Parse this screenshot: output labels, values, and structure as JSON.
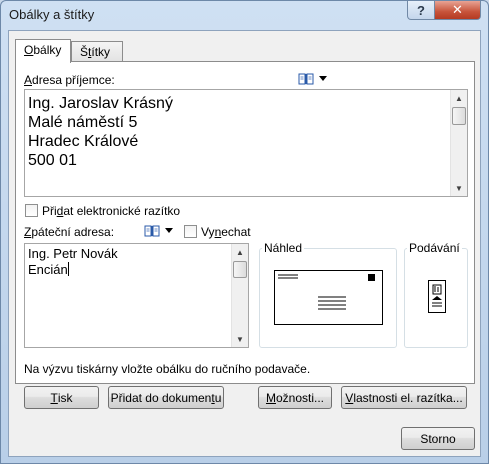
{
  "window": {
    "title": "Obálky a štítky",
    "help_glyph": "?",
    "close_glyph": "✕"
  },
  "tabs": [
    {
      "pre": "",
      "u": "O",
      "post": "bálky"
    },
    {
      "pre": "Š",
      "u": "t",
      "post": "ítky"
    }
  ],
  "recipient": {
    "label_pre": "",
    "label_u": "A",
    "label_post": "dresa příjemce:",
    "lines": [
      "Ing. Jaroslav Krásný",
      "Malé náměstí 5",
      "Hradec Králové",
      "500 01"
    ]
  },
  "e_stamp": {
    "pre": "Při",
    "u": "d",
    "post": "at elektronické razítko",
    "checked": false
  },
  "return": {
    "label_pre": "",
    "label_u": "Z",
    "label_post": "páteční adresa:",
    "lines": [
      "Ing. Petr Novák",
      "Encián"
    ]
  },
  "omit": {
    "pre": "Vy",
    "u": "n",
    "post": "echat",
    "checked": false
  },
  "preview": {
    "title": "Náhled"
  },
  "feed": {
    "title": "Podávání"
  },
  "instruction": "Na výzvu tiskárny vložte obálku do ručního podavače.",
  "buttons": {
    "print": {
      "pre": "",
      "u": "T",
      "post": "isk"
    },
    "add": {
      "pre": "Přidat do dokumen",
      "u": "t",
      "post": "u"
    },
    "options": {
      "pre": "",
      "u": "M",
      "post": "ožnosti..."
    },
    "stamp_props": {
      "pre": "",
      "u": "V",
      "post": "lastnosti el. razítka..."
    },
    "cancel": {
      "label": "Storno"
    }
  },
  "icons": {
    "address_book": "address-book-icon",
    "dropdown": "chevron-down-icon",
    "scroll_up": "▲",
    "scroll_down": "▼"
  }
}
